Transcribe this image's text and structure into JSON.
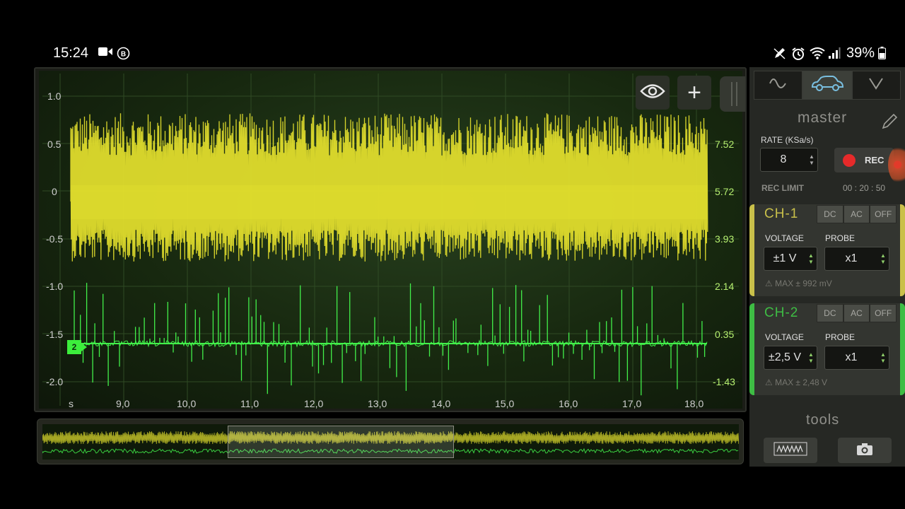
{
  "status_bar": {
    "time": "15:24",
    "left_icons": [
      "video-camera-icon",
      "b-circle-icon"
    ],
    "right_icons": [
      "pen-icon",
      "alarm-icon",
      "wifi-icon",
      "signal-icon",
      "battery-icon"
    ],
    "battery": "39%"
  },
  "scope": {
    "left_axis": [
      "1.0",
      "0.5",
      "0",
      "-0.5",
      "-1.0",
      "-1.5",
      "-2.0"
    ],
    "right_axis": [
      "7.52",
      "5.72",
      "3.93",
      "2.14",
      "0.35",
      "-1.43"
    ],
    "x_unit": "s",
    "x_ticks": [
      "9,0",
      "10,0",
      "11,0",
      "12,0",
      "13,0",
      "14,0",
      "15,0",
      "16,0",
      "17,0",
      "18,0"
    ],
    "channel_marker": "2",
    "colors": {
      "ch1": "#e6e22e",
      "ch2": "#42f04a",
      "grid": "#2f4a24"
    }
  },
  "overlay_buttons": {
    "eye": "eye-icon",
    "plus": "+"
  },
  "panel": {
    "tabs": [
      "sine-wave-icon",
      "car-icon",
      "chevron-down-icon"
    ],
    "title": "master",
    "rate_label": "RATE (KSa/s)",
    "rate_value": "8",
    "rec_label": "REC",
    "rec_limit_label": "REC LIMIT",
    "rec_limit_value": "00 : 20 : 50",
    "ch1": {
      "name": "CH-1",
      "modes": [
        "DC",
        "AC",
        "OFF"
      ],
      "voltage_label": "VOLTAGE",
      "probe_label": "PROBE",
      "voltage": "±1 V",
      "probe": "x1",
      "max": "⚠ MAX ±  992 mV"
    },
    "ch2": {
      "name": "CH-2",
      "modes": [
        "DC",
        "AC",
        "OFF"
      ],
      "voltage_label": "VOLTAGE",
      "probe_label": "PROBE",
      "voltage": "±2,5 V",
      "probe": "x1",
      "max": "⚠ MAX ±  2,48 V"
    },
    "tools_label": "tools"
  }
}
